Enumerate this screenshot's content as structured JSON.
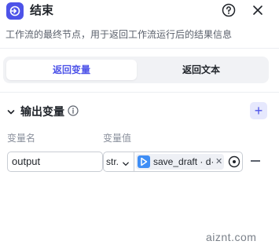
{
  "header": {
    "title": "结束",
    "icon": "end-node-icon",
    "accent": "#4d53e8",
    "help_icon": "help-circle-icon",
    "close_icon": "close-icon"
  },
  "description": "工作流的最终节点，用于返回工作流运行后的结果信息",
  "tabs": [
    {
      "label": "返回变量",
      "active": true
    },
    {
      "label": "返回文本",
      "active": false
    }
  ],
  "output_section": {
    "title": "输出变量",
    "add_icon": "plus-icon",
    "columns": {
      "name": "变量名",
      "value": "变量值"
    },
    "rows": [
      {
        "name": "output",
        "type": "str.",
        "reference": "save_draft · d·",
        "reference_icon": "workflow-node-icon",
        "reference_color": "#3f8ef5"
      }
    ]
  },
  "watermark": "aiznt.com"
}
